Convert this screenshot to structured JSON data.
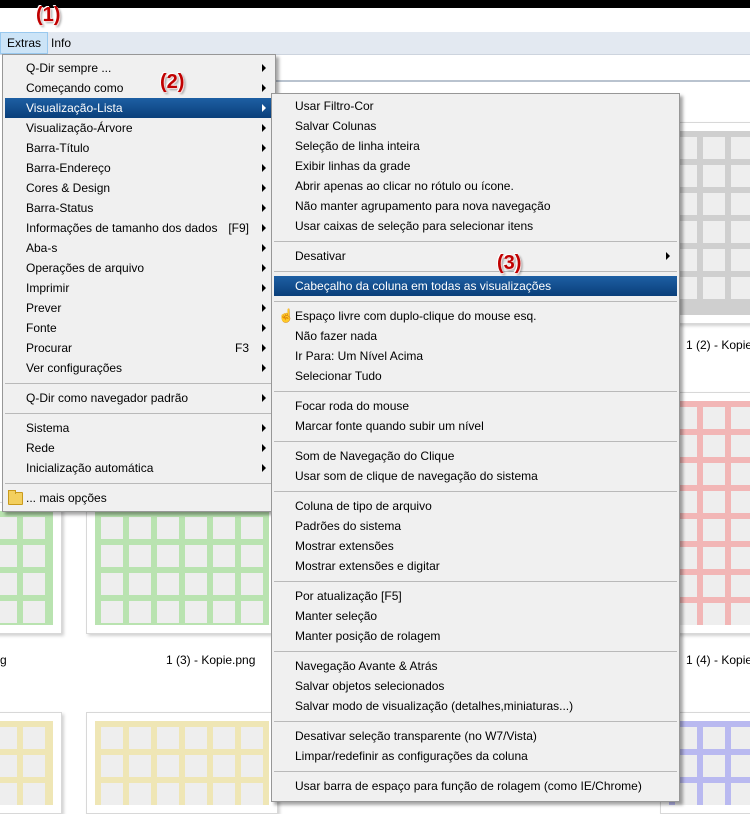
{
  "menubar": {
    "extras": "Extras",
    "info": "Info"
  },
  "annotations": {
    "a1": "(1)",
    "a2": "(2)",
    "a3": "(3)"
  },
  "background": {
    "captions": [
      "1 (2) - Kopie",
      "1 (3) - Kopie.png",
      "1 (4) - Kopie",
      "g"
    ]
  },
  "menu_extras": {
    "items": [
      {
        "label": "Q-Dir sempre ...",
        "submenu": true
      },
      {
        "label": "Começando como",
        "submenu": true
      },
      {
        "label": "Visualização-Lista",
        "submenu": true,
        "highlight": true
      },
      {
        "label": "Visualização-Árvore",
        "submenu": true
      },
      {
        "label": "Barra-Título",
        "submenu": true
      },
      {
        "label": "Barra-Endereço",
        "submenu": true
      },
      {
        "label": "Cores & Design",
        "submenu": true
      },
      {
        "label": "Barra-Status",
        "submenu": true
      },
      {
        "label": "Informações de tamanho dos dados",
        "shortcut": "[F9]",
        "submenu": true
      },
      {
        "label": "Aba-s",
        "submenu": true
      },
      {
        "label": "Operações de arquivo",
        "submenu": true
      },
      {
        "label": "Imprimir",
        "submenu": true
      },
      {
        "label": "Prever",
        "submenu": true
      },
      {
        "label": "Fonte",
        "submenu": true
      },
      {
        "label": "Procurar",
        "shortcut": "F3",
        "submenu": true
      },
      {
        "label": "Ver configurações",
        "submenu": true
      },
      {
        "sep": true
      },
      {
        "label": "Q-Dir como navegador padrão",
        "submenu": true
      },
      {
        "sep": true
      },
      {
        "label": "Sistema",
        "submenu": true
      },
      {
        "label": "Rede",
        "submenu": true
      },
      {
        "label": "Inicialização automática",
        "submenu": true
      },
      {
        "sep": true
      },
      {
        "label": "... mais opções",
        "icon": "folder-icon"
      }
    ]
  },
  "menu_lista": {
    "items": [
      {
        "label": "Usar Filtro-Cor"
      },
      {
        "label": "Salvar Colunas"
      },
      {
        "label": "Seleção de linha inteira"
      },
      {
        "label": "Exibir linhas da grade"
      },
      {
        "label": "Abrir apenas ao clicar no rótulo ou ícone."
      },
      {
        "label": "Não manter agrupamento para nova navegação"
      },
      {
        "label": "Usar caixas de seleção para selecionar itens"
      },
      {
        "sep": true
      },
      {
        "label": "Desativar",
        "submenu": true
      },
      {
        "sep": true
      },
      {
        "label": "Cabeçalho da coluna em todas as visualizações",
        "highlight": true
      },
      {
        "sep": true
      },
      {
        "label": "Espaço livre com duplo-clique do mouse esq.",
        "icon": "hand-cursor-icon"
      },
      {
        "label": "Não fazer nada"
      },
      {
        "label": "Ir Para: Um Nível Acima"
      },
      {
        "label": "Selecionar Tudo"
      },
      {
        "sep": true
      },
      {
        "label": "Focar roda do mouse"
      },
      {
        "label": "Marcar fonte quando subir um nível"
      },
      {
        "sep": true
      },
      {
        "label": "Som de Navegação do Clique"
      },
      {
        "label": "Usar som de clique de navegação do sistema"
      },
      {
        "sep": true
      },
      {
        "label": "Coluna de tipo de arquivo"
      },
      {
        "label": "Padrões do sistema"
      },
      {
        "label": "Mostrar extensões"
      },
      {
        "label": "Mostrar extensões e digitar"
      },
      {
        "sep": true
      },
      {
        "label": "Por atualização [F5]"
      },
      {
        "label": "Manter seleção"
      },
      {
        "label": "Manter posição de rolagem"
      },
      {
        "sep": true
      },
      {
        "label": "Navegação Avante & Atrás"
      },
      {
        "label": "Salvar objetos selecionados"
      },
      {
        "label": "Salvar modo de visualização (detalhes,miniaturas...)"
      },
      {
        "sep": true
      },
      {
        "label": "Desativar seleção transparente (no W7/Vista)"
      },
      {
        "label": "Limpar/redefinir as configurações da coluna"
      },
      {
        "sep": true
      },
      {
        "label": "Usar barra de espaço para função de rolagem (como IE/Chrome)"
      }
    ]
  },
  "colors": {
    "highlight": "#0a3f7a",
    "annotation": "#c00000",
    "thumb_green": "#b9e3b0",
    "thumb_grey": "#cfcfcf",
    "thumb_red": "#f2b6b6",
    "thumb_yellow": "#efe6b5",
    "thumb_blue": "#b9b9f0"
  }
}
